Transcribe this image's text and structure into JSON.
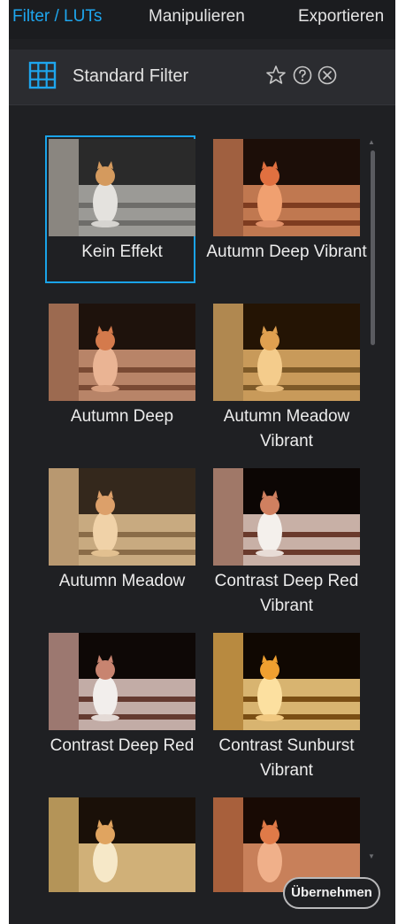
{
  "tabs": [
    {
      "label": "Filter / LUTs"
    },
    {
      "label": "Manipulieren"
    },
    {
      "label": "Exportieren"
    }
  ],
  "panel": {
    "title": "Standard Filter"
  },
  "colors": {
    "accent": "#1ea6ee",
    "background": "#1f2023",
    "header": "#2b2c30"
  },
  "icons": [
    "grid-icon",
    "star-icon",
    "help-icon",
    "close-icon"
  ],
  "filters": [
    {
      "label": "Kein Effekt",
      "selected": true
    },
    {
      "label": "Autumn Deep Vibrant",
      "selected": false
    },
    {
      "label": "Autumn Deep",
      "selected": false
    },
    {
      "label": "Autumn Meadow Vibrant",
      "selected": false
    },
    {
      "label": "Autumn Meadow",
      "selected": false
    },
    {
      "label": "Contrast Deep Red Vibrant",
      "selected": false
    },
    {
      "label": "Contrast Deep Red",
      "selected": false
    },
    {
      "label": "Contrast Sunburst Vibrant",
      "selected": false
    },
    {
      "label": "",
      "selected": false
    },
    {
      "label": "",
      "selected": false
    }
  ],
  "footer": {
    "apply_label": "Übernehmen"
  }
}
